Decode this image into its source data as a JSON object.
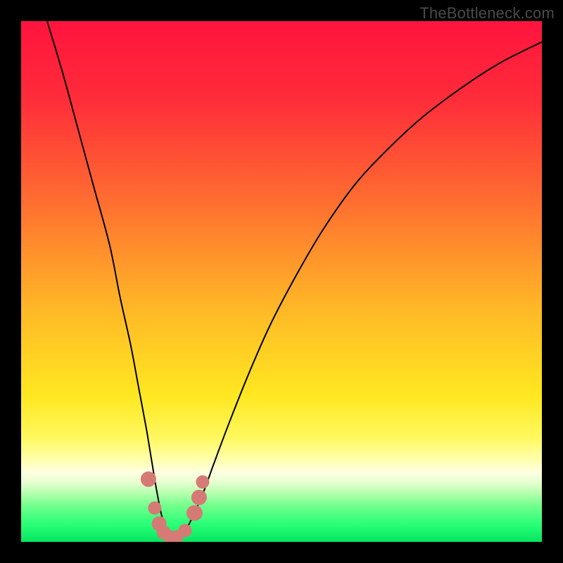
{
  "watermark": "TheBottleneck.com",
  "colors": {
    "frame": "#000000",
    "curve": "#000000",
    "dot_fill": "#d57a75",
    "gradient_stops": [
      {
        "offset": 0.0,
        "color": "#ff143e"
      },
      {
        "offset": 0.15,
        "color": "#ff2c3a"
      },
      {
        "offset": 0.35,
        "color": "#ff6f30"
      },
      {
        "offset": 0.55,
        "color": "#ffb727"
      },
      {
        "offset": 0.72,
        "color": "#ffe821"
      },
      {
        "offset": 0.8,
        "color": "#fff85f"
      },
      {
        "offset": 0.84,
        "color": "#ffffa8"
      },
      {
        "offset": 0.865,
        "color": "#ffffe0"
      },
      {
        "offset": 0.885,
        "color": "#e8ffd2"
      },
      {
        "offset": 0.905,
        "color": "#b9ffb0"
      },
      {
        "offset": 0.93,
        "color": "#74ff8d"
      },
      {
        "offset": 0.965,
        "color": "#2bff77"
      },
      {
        "offset": 1.0,
        "color": "#05e661"
      }
    ]
  },
  "chart_data": {
    "type": "line",
    "title": "",
    "xlabel": "",
    "ylabel": "",
    "xlim": [
      0,
      100
    ],
    "ylim": [
      0,
      100
    ],
    "series": [
      {
        "name": "bottleneck-curve",
        "x": [
          5,
          8,
          11,
          14,
          17,
          19,
          21,
          22.5,
          24,
          25,
          26,
          27,
          28,
          29,
          30,
          31.5,
          33,
          35,
          37,
          40,
          44,
          48,
          53,
          58,
          64,
          70,
          77,
          85,
          92,
          100
        ],
        "y": [
          100,
          90,
          79,
          68,
          57,
          47,
          38,
          30,
          22,
          16,
          10,
          5,
          2,
          0.5,
          0.5,
          2,
          5,
          9.5,
          15,
          23,
          33,
          42,
          51.5,
          60,
          68.5,
          75,
          81.5,
          87.5,
          92,
          96
        ]
      }
    ],
    "markers": [
      {
        "x": 24.5,
        "y": 12,
        "r": 1.5
      },
      {
        "x": 25.7,
        "y": 6.5,
        "r": 1.3
      },
      {
        "x": 26.5,
        "y": 3.5,
        "r": 1.4
      },
      {
        "x": 27.4,
        "y": 1.8,
        "r": 1.4
      },
      {
        "x": 28.6,
        "y": 0.9,
        "r": 1.3
      },
      {
        "x": 29.8,
        "y": 0.9,
        "r": 1.3
      },
      {
        "x": 31.5,
        "y": 2.2,
        "r": 1.3
      },
      {
        "x": 33.3,
        "y": 5.5,
        "r": 1.5
      },
      {
        "x": 34.2,
        "y": 8.5,
        "r": 1.5
      },
      {
        "x": 34.8,
        "y": 11.5,
        "r": 1.3
      }
    ]
  }
}
